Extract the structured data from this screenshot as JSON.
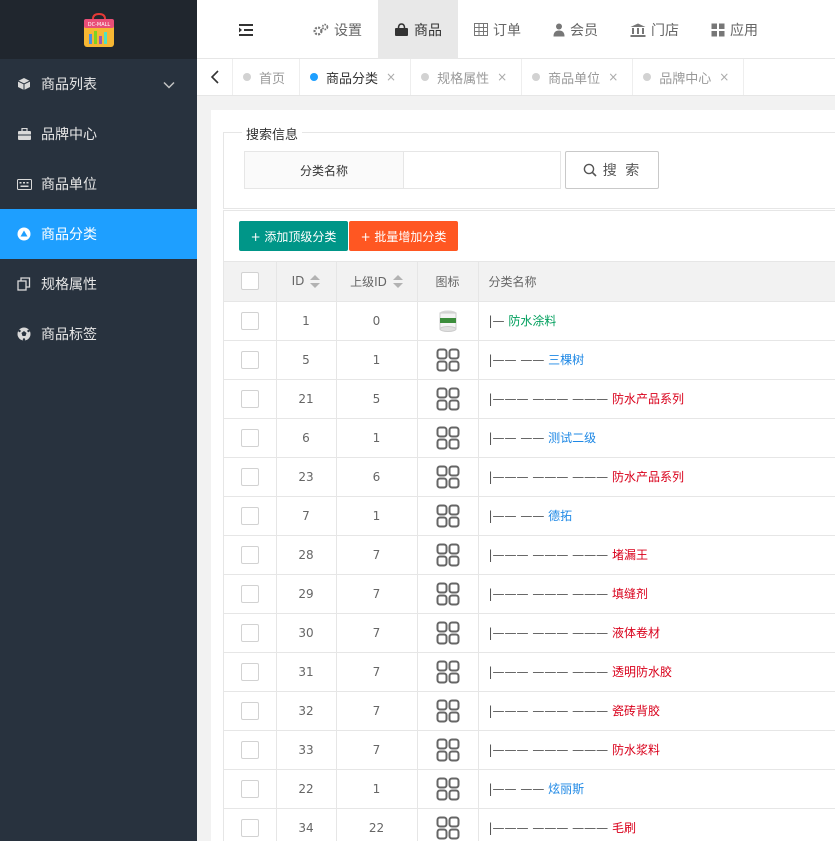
{
  "app": {
    "logo_text": "DC-MALL"
  },
  "sidebar": {
    "items": [
      {
        "label": "商品列表",
        "icon": "cube-icon",
        "has_children": true
      },
      {
        "label": "品牌中心",
        "icon": "briefcase-icon"
      },
      {
        "label": "商品单位",
        "icon": "keyboard-icon"
      },
      {
        "label": "商品分类",
        "icon": "triangle-circle-icon",
        "active": true
      },
      {
        "label": "规格属性",
        "icon": "copy-icon"
      },
      {
        "label": "商品标签",
        "icon": "soccer-ball-icon"
      }
    ]
  },
  "topnav": {
    "items": [
      {
        "label": "设置",
        "icon": "gears-icon"
      },
      {
        "label": "商品",
        "icon": "shopping-bag-icon",
        "active": true
      },
      {
        "label": "订单",
        "icon": "table-icon"
      },
      {
        "label": "会员",
        "icon": "user-icon"
      },
      {
        "label": "门店",
        "icon": "bank-icon"
      },
      {
        "label": "应用",
        "icon": "grid-icon"
      }
    ]
  },
  "tabs": {
    "items": [
      {
        "label": "首页",
        "closable": false
      },
      {
        "label": "商品分类",
        "active": true,
        "closable": true
      },
      {
        "label": "规格属性",
        "closable": true
      },
      {
        "label": "商品单位",
        "closable": true
      },
      {
        "label": "品牌中心",
        "closable": true
      }
    ],
    "close_glyph": "×"
  },
  "search": {
    "legend": "搜索信息",
    "field_label": "分类名称",
    "value": "",
    "placeholder": "",
    "button_label": "搜 索"
  },
  "toolbar": {
    "add_top_label": "+ 添加顶级分类",
    "batch_add_label": "+ 批量增加分类"
  },
  "table": {
    "columns": [
      "ID",
      "上级ID",
      "图标",
      "分类名称"
    ],
    "rows": [
      {
        "id": "1",
        "pid": "0",
        "icon": "product-image",
        "prefix": "|— ",
        "name": "防水涂料",
        "level": 0
      },
      {
        "id": "5",
        "pid": "1",
        "icon": "grid-icon",
        "prefix": "|—— —— ",
        "name": "三棵树",
        "level": 1
      },
      {
        "id": "21",
        "pid": "5",
        "icon": "grid-icon",
        "prefix": "|——— ——— ——— ",
        "name": "防水产品系列",
        "level": 2
      },
      {
        "id": "6",
        "pid": "1",
        "icon": "grid-icon",
        "prefix": "|—— —— ",
        "name": "测试二级",
        "level": 1
      },
      {
        "id": "23",
        "pid": "6",
        "icon": "grid-icon",
        "prefix": "|——— ——— ——— ",
        "name": "防水产品系列",
        "level": 2
      },
      {
        "id": "7",
        "pid": "1",
        "icon": "grid-icon",
        "prefix": "|—— —— ",
        "name": "德拓",
        "level": 1
      },
      {
        "id": "28",
        "pid": "7",
        "icon": "grid-icon",
        "prefix": "|——— ——— ——— ",
        "name": "堵漏王",
        "level": 2
      },
      {
        "id": "29",
        "pid": "7",
        "icon": "grid-icon",
        "prefix": "|——— ——— ——— ",
        "name": "填缝剂",
        "level": 2
      },
      {
        "id": "30",
        "pid": "7",
        "icon": "grid-icon",
        "prefix": "|——— ——— ——— ",
        "name": "液体卷材",
        "level": 2
      },
      {
        "id": "31",
        "pid": "7",
        "icon": "grid-icon",
        "prefix": "|——— ——— ——— ",
        "name": "透明防水胶",
        "level": 2
      },
      {
        "id": "32",
        "pid": "7",
        "icon": "grid-icon",
        "prefix": "|——— ——— ——— ",
        "name": "瓷砖背胶",
        "level": 2
      },
      {
        "id": "33",
        "pid": "7",
        "icon": "grid-icon",
        "prefix": "|——— ——— ——— ",
        "name": "防水浆料",
        "level": 2
      },
      {
        "id": "22",
        "pid": "1",
        "icon": "grid-icon",
        "prefix": "|—— —— ",
        "name": "炫丽斯",
        "level": 1
      },
      {
        "id": "34",
        "pid": "22",
        "icon": "grid-icon",
        "prefix": "|——— ——— ——— ",
        "name": "毛刷",
        "level": 2
      }
    ]
  },
  "colors": {
    "sidebar_bg": "#28323e",
    "active_blue": "#1e9fff",
    "add_button": "#009688",
    "batch_button": "#ff5722",
    "level0_text": "#009f5d",
    "level1_text": "#1e88e5",
    "level2_text": "#d9001b"
  }
}
